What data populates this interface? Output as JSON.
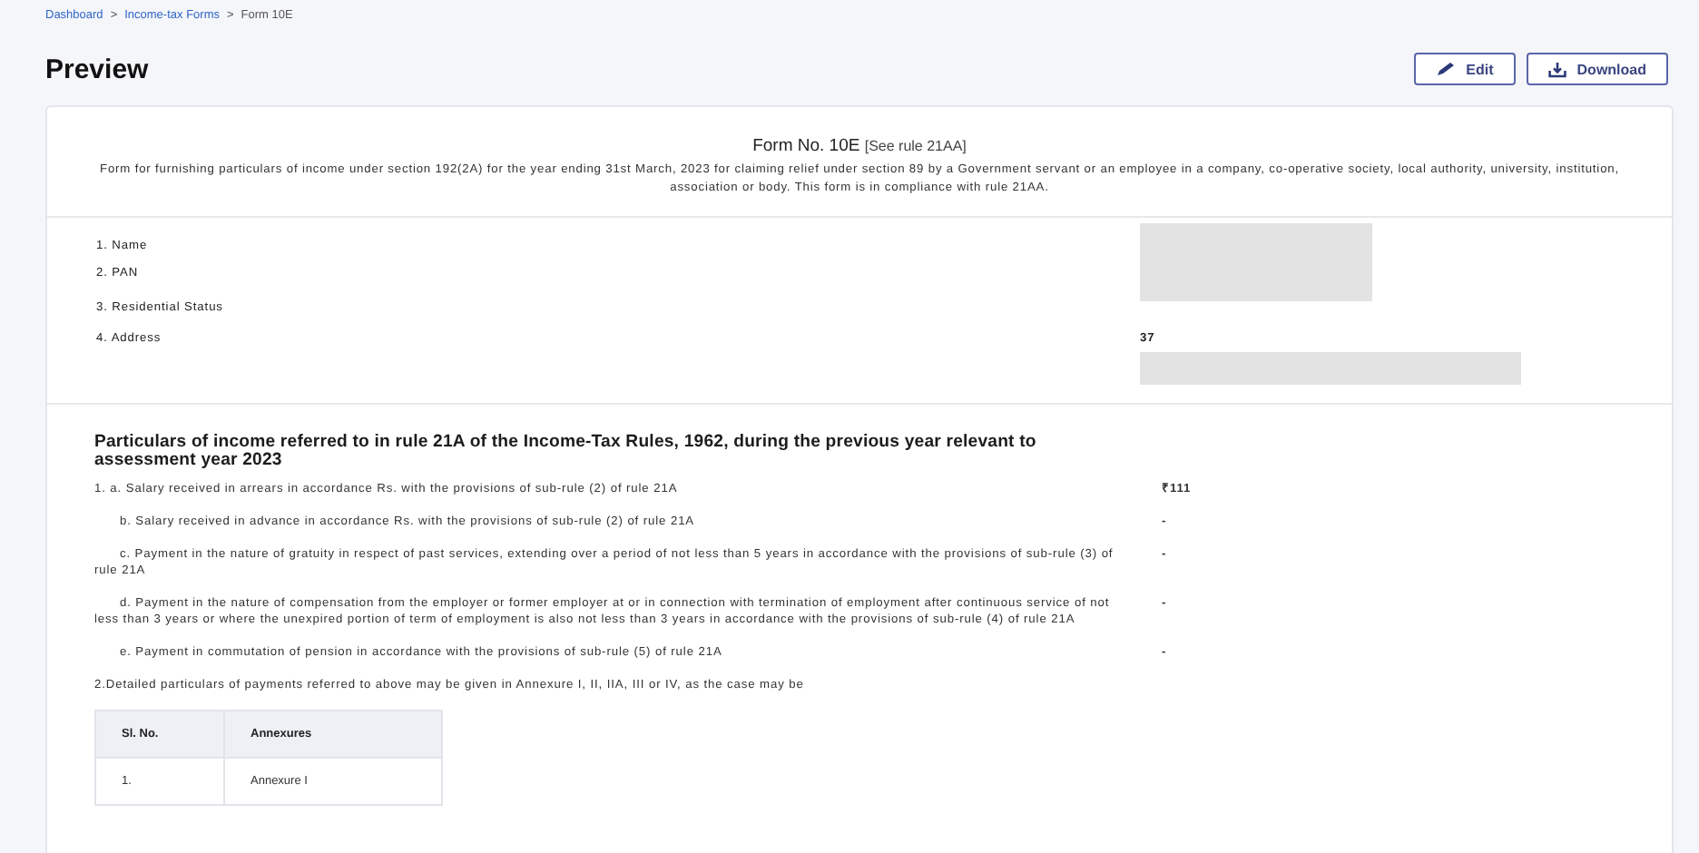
{
  "breadcrumb": [
    {
      "label": "Dashboard",
      "link": true
    },
    {
      "label": "Income-tax Forms",
      "link": true
    },
    {
      "label": "Form 10E",
      "link": false
    }
  ],
  "separator": ">",
  "title": "Preview",
  "actions": [
    {
      "label": "Edit"
    },
    {
      "label": "Download"
    }
  ],
  "form": {
    "name": "Form No. 10E",
    "rule": "[See rule 21AA]",
    "description": "Form for furnishing particulars of income under section 192(2A) for the year ending 31st March, 2023 for claiming relief under section 89 by a Government servant or an employee in a company, co-operative society, local authority, university, institution, association or body. This form is in compliance with rule 21AA."
  },
  "details": [
    {
      "label": "1. Name",
      "redacted": true
    },
    {
      "label": "2. PAN",
      "redacted": true
    },
    {
      "label": "3. Residential Status",
      "redacted": false
    },
    {
      "label": "4. Address",
      "value": "37",
      "redacted": true
    }
  ],
  "section": {
    "heading": "Particulars of income referred to in rule 21A of the Income-Tax Rules, 1962, during the previous year relevant to assessment year 2023",
    "items": [
      {
        "kind": "main",
        "text": "1. a. Salary received in arrears in accordance Rs. with the provisions of sub-rule (2) of rule 21A",
        "value": "₹111"
      },
      {
        "kind": "sub",
        "text": "b. Salary received in advance in accordance Rs. with the provisions of sub-rule (2) of rule 21A",
        "value": "-"
      },
      {
        "kind": "sub",
        "text": "c. Payment in the nature of gratuity in respect of past services, extending over a period of not less than 5 years in accordance with the provisions of sub-rule (3) of rule 21A",
        "value": "-"
      },
      {
        "kind": "sub",
        "text": "d. Payment in the nature of compensation from the employer or former employer at or in connection with termination of employment after continuous service of not less than 3 years or where the unexpired portion of term of employment is also not less than 3 years in accordance with the provisions of sub-rule (4) of rule 21A",
        "value": "-"
      },
      {
        "kind": "sub",
        "text": "e. Payment in commutation of pension in accordance with the provisions of sub-rule (5) of rule 21A",
        "value": "-"
      },
      {
        "kind": "note",
        "text": "2.Detailed particulars of payments referred to above may be given in Annexure I, II, IIA, III or IV, as the case may be"
      }
    ]
  },
  "annexure_table": {
    "columns": [
      "Sl. No.",
      "Annexures"
    ],
    "rows": [
      [
        "1.",
        "Annexure I"
      ]
    ]
  }
}
